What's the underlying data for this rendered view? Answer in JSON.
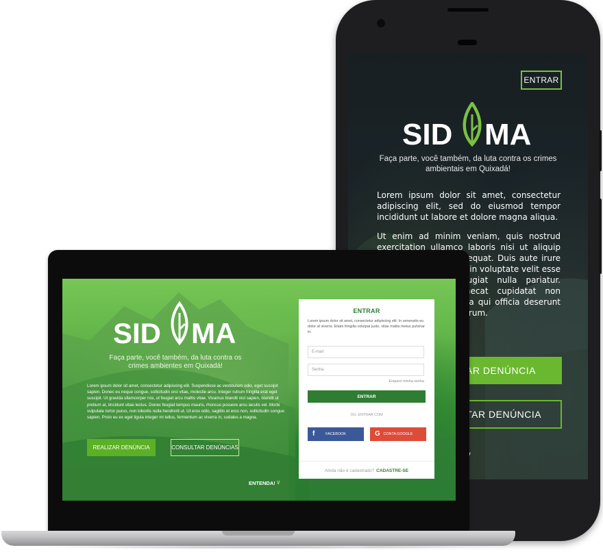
{
  "brand": {
    "name": "SIDEMA",
    "accent": "#6ab82f",
    "dark_green": "#2e7d32"
  },
  "phone": {
    "entrar_label": "ENTRAR",
    "tagline": "Faça parte, você também, da luta contra os crimes ambientais em Quixadá!",
    "lorem_p1": "Lorem ipsum dolor sit amet, consectetur adipiscing elit, sed do eiusmod tempor incididunt ut labore et dolore magna aliqua.",
    "lorem_p2": "Ut enim ad minim veniam, quis nostrud exercitation ullamco laboris nisi ut aliquip ex ea commodo consequat. Duis aute irure dolor in reprehenderit in voluptate velit esse cillum dolore eu fugiat nulla pariatur. Excepteur sint occaecat cupidatat non proident, sunt in culpa qui officia deserunt mollit anim id est laborum.",
    "btn_realizar": "REALIZAR DENÚNCIA",
    "btn_consultar": "CONSULTAR DENÚNCIA"
  },
  "laptop": {
    "tagline": "Faça parte, você também, da luta contra os crimes ambientes em Quixadá!",
    "lorem": "Lorem ipsum dolor sit amet, consectetur adipiscing elit. Suspendisse ac vestibulum odio, eget suscipit sapien. Donec eu neque congue, sollicitudin orci vitae, molestie arcu. Integer rutrum fringilla erat eget suscipit. Ut gravida ullamcorper nisi, ut feugiat arcu mattis vitae. Vivamus blandit nisl sapien, blandit ut pretium at, tincidunt vitae lectus. Donec feugiat tempus mauris, rhoncus posuere arcu iaculis vel. Morbi vulputate tortor purus, non lobortis nulla hendrerit ut. Ut eros odio, sagittis et eros non, sollicitudin congue sapien. Proin eu ex eget ligula integer mi tellus, fermentum ac viverra in, sodales a magna.",
    "btn_realizar": "REALIZAR DENÚNCIA",
    "btn_consultar": "CONSULTAR DENÚNCIAS",
    "entenda": "ENTENDA!",
    "login": {
      "title": "ENTRAR",
      "desc": "Lorem ipsum dolor sit amet, consectetur adipiscing elit. In venenatis eu dolor at viverra. Etiam fringilla volutpat justo, vitae mattis metus pulvinar in.",
      "email_placeholder": "E-mail",
      "password_placeholder": "Senha",
      "forgot": "Esqueci minha senha",
      "enter_button": "ENTRAR",
      "or_text": "OU, ENTRAR COM",
      "facebook": "FACEBOOK",
      "google": "CONTA GOOGLE",
      "not_registered": "Ainda não é cadastrado?",
      "register": "CADASTRE-SE"
    }
  }
}
